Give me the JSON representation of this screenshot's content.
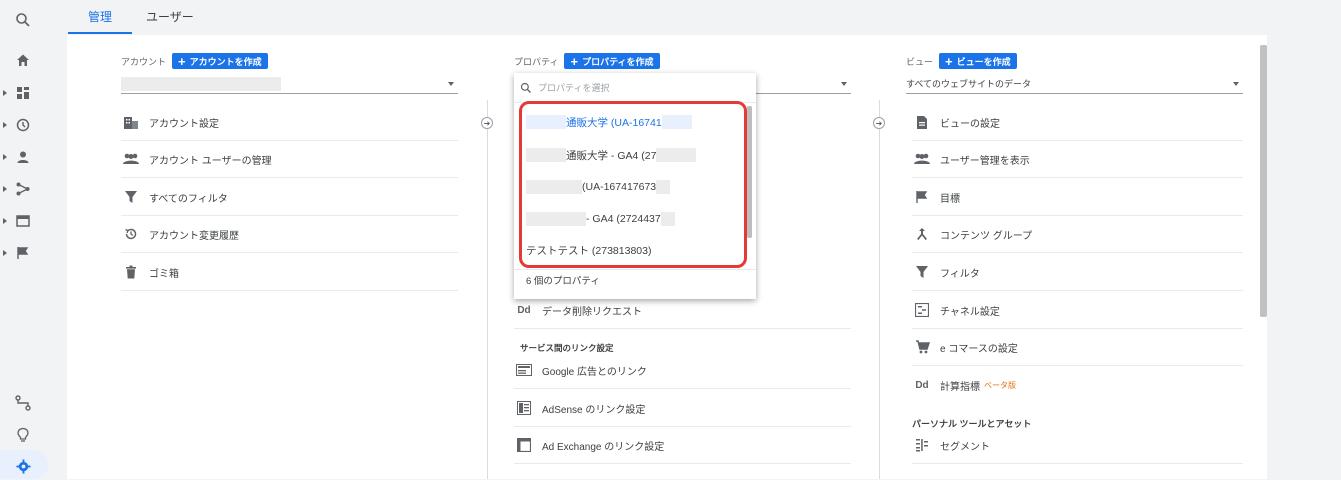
{
  "tabs": {
    "admin": "管理",
    "user": "ユーザー"
  },
  "account": {
    "label": "アカウント",
    "create_label": "アカウントを作成",
    "items": [
      "アカウント設定",
      "アカウント ユーザーの管理",
      "すべてのフィルタ",
      "アカウント変更履歴",
      "ゴミ箱"
    ]
  },
  "property": {
    "label": "プロパティ",
    "create_label": "プロパティを作成",
    "items_below": [
      "データ削除リクエスト"
    ],
    "link_section_title": "サービス間のリンク設定",
    "links": [
      "Google 広告とのリンク",
      "AdSense のリンク設定",
      "Ad Exchange のリンク設定"
    ]
  },
  "dropdown": {
    "search_placeholder": "プロパティを選択",
    "options": [
      "通販大学 (UA-16741",
      "通販大学 - GA4 (27",
      "(UA-167417673",
      "- GA4 (2724437",
      "テストテスト (273813803)"
    ],
    "footer": "6 個のプロパティ"
  },
  "view": {
    "label": "ビュー",
    "create_label": "ビューを作成",
    "selected": "すべてのウェブサイトのデータ",
    "items": [
      "ビューの設定",
      "ユーザー管理を表示",
      "目標",
      "コンテンツ グループ",
      "フィルタ",
      "チャネル設定",
      "e コマースの設定",
      "計算指標"
    ],
    "beta": "ベータ版",
    "section_title": "パーソナル ツールとアセット",
    "tools": [
      "セグメント"
    ]
  },
  "colors": {
    "accent": "#1a73e8",
    "highlight": "#e53935",
    "beta": "#e8710a"
  }
}
